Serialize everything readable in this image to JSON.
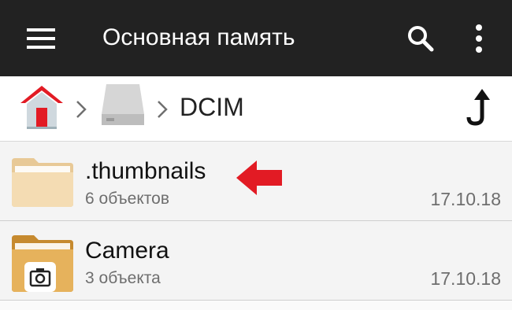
{
  "appbar": {
    "title": "Основная память",
    "menu_icon": "hamburger-menu-icon",
    "search_icon": "search-icon",
    "more_icon": "more-vert-icon",
    "background": "#222222"
  },
  "breadcrumb": {
    "home_icon": "home-icon",
    "drive_icon": "storage-drive-icon",
    "current": "DCIM",
    "up_icon": "navigate-up-icon"
  },
  "files": [
    {
      "name": ".thumbnails",
      "meta": "6 объектов",
      "date": "17.10.18",
      "icon": "folder-icon",
      "annotation": "red-arrow-icon"
    },
    {
      "name": "Camera",
      "meta": "3 объекта",
      "date": "17.10.18",
      "icon": "camera-folder-icon"
    }
  ],
  "colors": {
    "accent_red": "#e21b24",
    "folder": "#f2d9ae"
  }
}
